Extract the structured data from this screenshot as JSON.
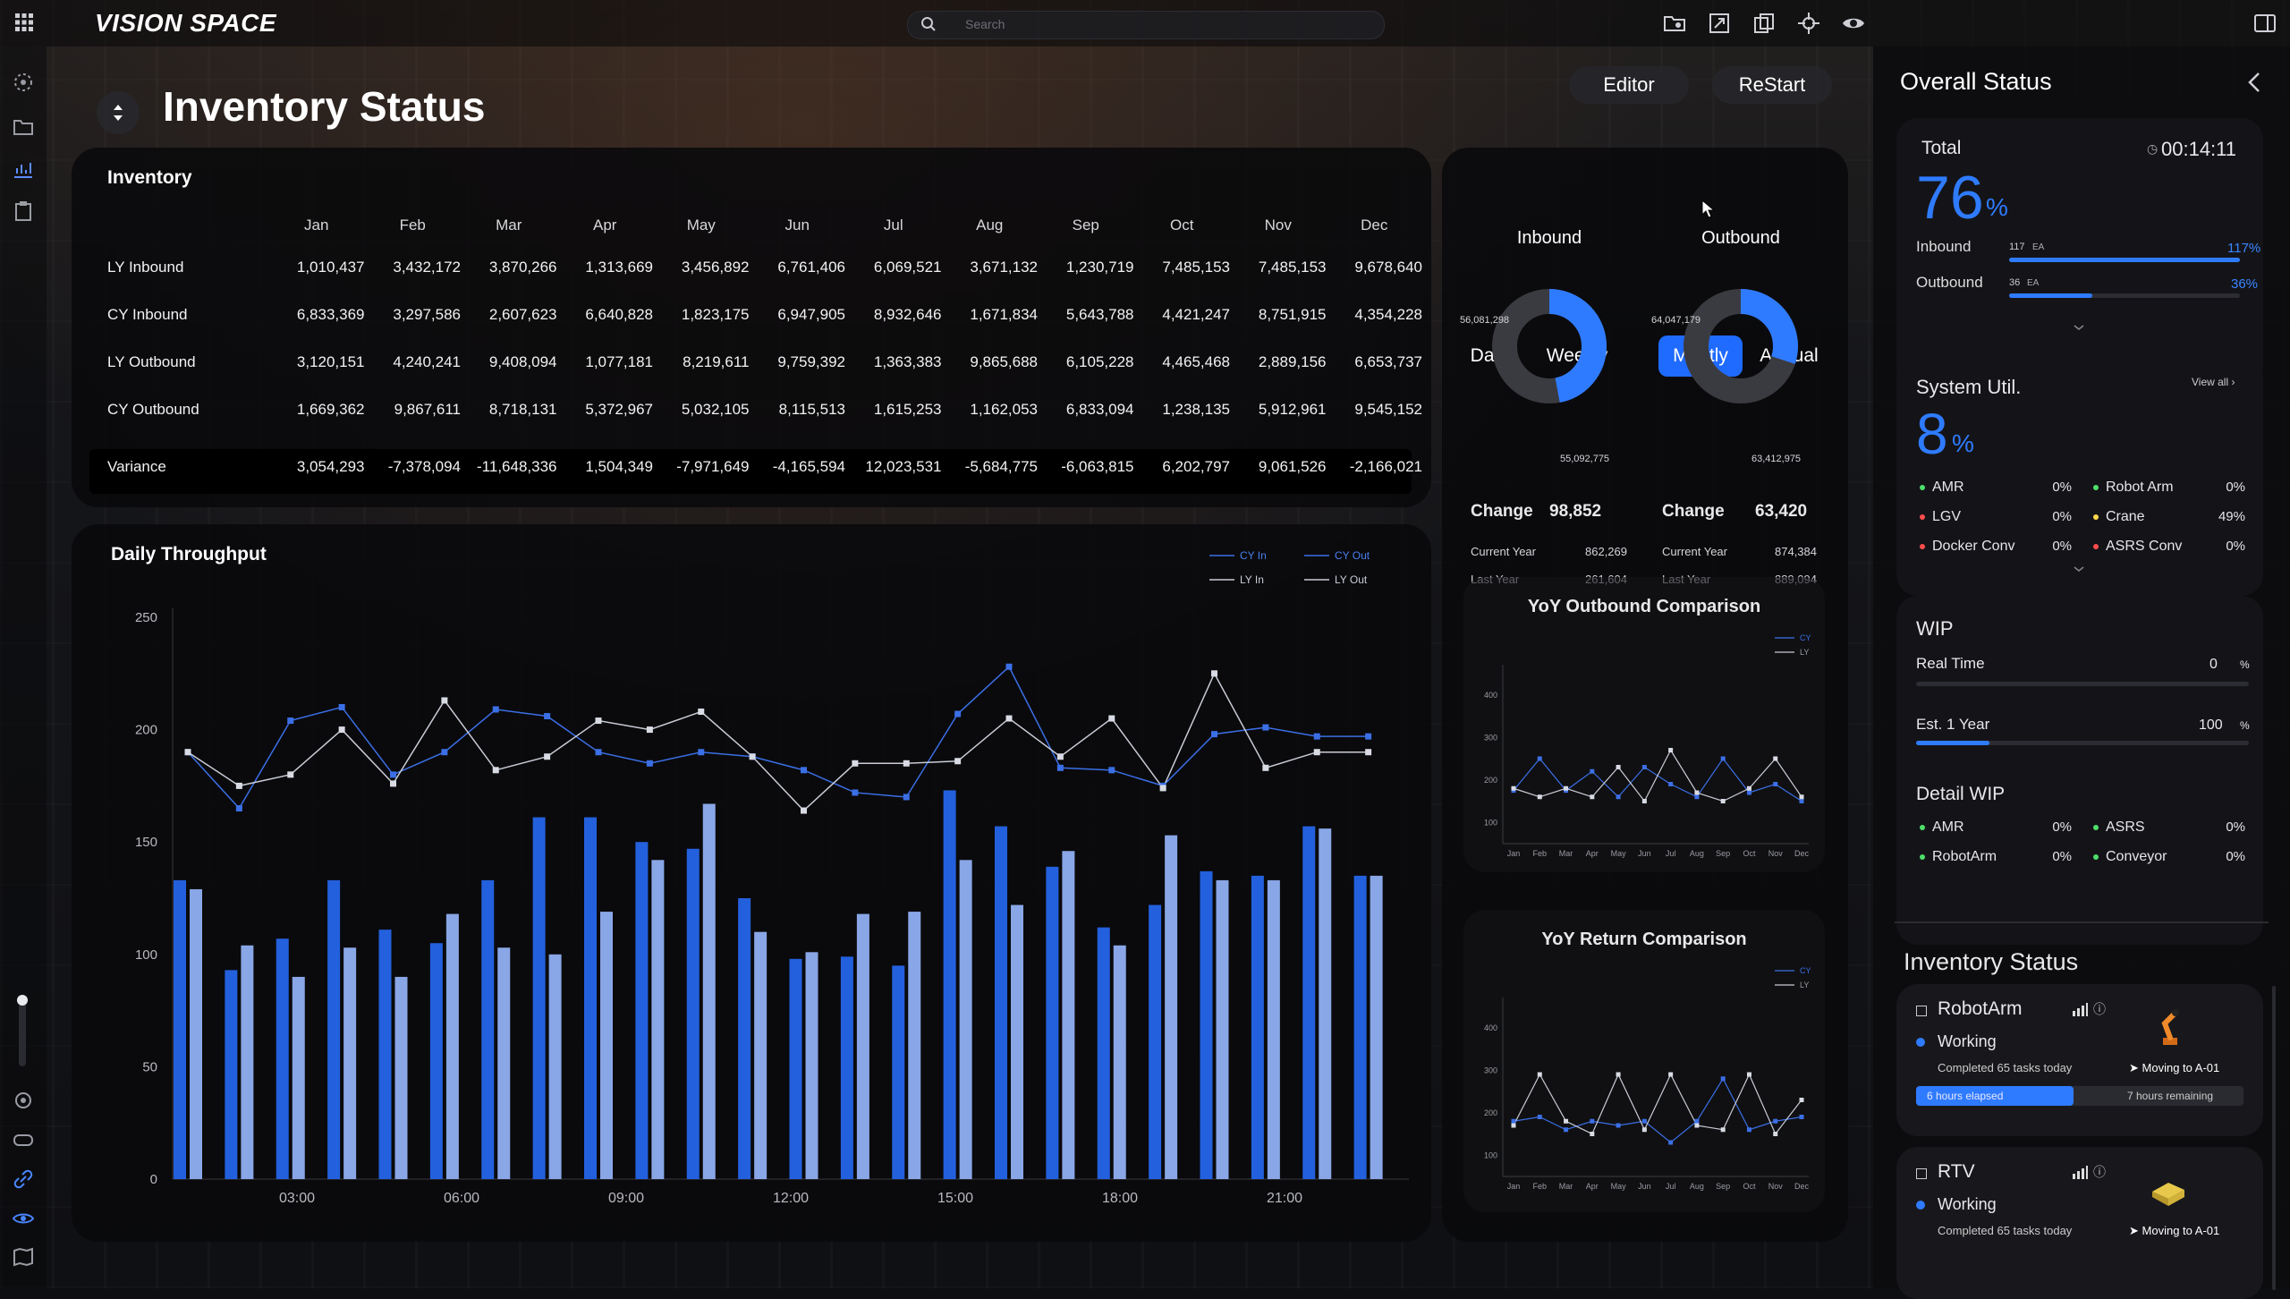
{
  "app": {
    "brand": "VISION SPACE",
    "search_placeholder": "Search"
  },
  "header": {
    "title": "Inventory Status",
    "editor_label": "Editor",
    "restart_label": "ReStart"
  },
  "inventory": {
    "title": "Inventory",
    "months": [
      "Jan",
      "Feb",
      "Mar",
      "Apr",
      "May",
      "Jun",
      "Jul",
      "Aug",
      "Sep",
      "Oct",
      "Nov",
      "Dec"
    ],
    "rows": [
      {
        "label": "LY Inbound",
        "values": [
          "1,010,437",
          "3,432,172",
          "3,870,266",
          "1,313,669",
          "3,456,892",
          "6,761,406",
          "6,069,521",
          "3,671,132",
          "1,230,719",
          "7,485,153",
          "7,485,153",
          "9,678,640"
        ]
      },
      {
        "label": "CY Inbound",
        "values": [
          "6,833,369",
          "3,297,586",
          "2,607,623",
          "6,640,828",
          "1,823,175",
          "6,947,905",
          "8,932,646",
          "1,671,834",
          "5,643,788",
          "4,421,247",
          "8,751,915",
          "4,354,228"
        ]
      },
      {
        "label": "LY Outbound",
        "values": [
          "3,120,151",
          "4,240,241",
          "9,408,094",
          "1,077,181",
          "8,219,611",
          "9,759,392",
          "1,363,383",
          "9,865,688",
          "6,105,228",
          "4,465,468",
          "2,889,156",
          "6,653,737"
        ]
      },
      {
        "label": "CY Outbound",
        "values": [
          "1,669,362",
          "9,867,611",
          "8,718,131",
          "5,372,967",
          "5,032,105",
          "8,115,513",
          "1,615,253",
          "1,162,053",
          "6,833,094",
          "1,238,135",
          "5,912,961",
          "9,545,152"
        ]
      }
    ],
    "variance": {
      "label": "Variance",
      "values": [
        "3,054,293",
        "-7,378,094",
        "-11,648,336",
        "1,504,349",
        "-7,971,649",
        "-4,165,594",
        "12,023,531",
        "-5,684,775",
        "-6,063,815",
        "6,202,797",
        "9,061,526",
        "-2,166,021"
      ]
    }
  },
  "period_tabs": [
    "Daily",
    "Weekly",
    "Montly",
    "Annual"
  ],
  "active_tab": "Montly",
  "inbound": {
    "title": "Inbound",
    "a": "56,081,298",
    "b": "55,092,775",
    "change_label": "Change",
    "change": "98,852",
    "cy_label": "Current Year",
    "cy": "862,269",
    "ly_label": "Last Year",
    "ly": "261,604",
    "share": 0.47
  },
  "outbound": {
    "title": "Outbound",
    "a": "64,047,179",
    "b": "63,412,975",
    "change_label": "Change",
    "change": "63,420",
    "cy_label": "Current Year",
    "cy": "874,384",
    "ly_label": "Last Year",
    "ly": "889,094",
    "share": 0.3
  },
  "yoy_outbound": {
    "title": "YoY Outbound Comparison",
    "legend": [
      "CY",
      "LY"
    ],
    "months": [
      "Jan",
      "Feb",
      "Mar",
      "Apr",
      "May",
      "Jun",
      "Jul",
      "Aug",
      "Sep",
      "Oct",
      "Nov",
      "Dec"
    ],
    "yticks": [
      "400",
      "300",
      "200",
      "100"
    ],
    "cy": [
      175,
      250,
      175,
      220,
      160,
      230,
      190,
      160,
      250,
      170,
      190,
      150
    ],
    "ly": [
      180,
      160,
      180,
      160,
      230,
      150,
      270,
      170,
      150,
      180,
      250,
      160
    ]
  },
  "yoy_return": {
    "title": "YoY Return Comparison",
    "legend": [
      "CY",
      "LY"
    ],
    "months": [
      "Jan",
      "Feb",
      "Mar",
      "Apr",
      "May",
      "Jun",
      "Jul",
      "Aug",
      "Sep",
      "Oct",
      "Nov",
      "Dec"
    ],
    "yticks": [
      "400",
      "300",
      "200",
      "100"
    ],
    "cy": [
      180,
      190,
      160,
      180,
      170,
      180,
      130,
      180,
      280,
      160,
      180,
      190
    ],
    "ly": [
      170,
      290,
      180,
      150,
      290,
      160,
      290,
      170,
      160,
      290,
      150,
      230
    ]
  },
  "overall": {
    "title": "Overall Status",
    "total_label": "Total",
    "total_value": "76",
    "pct": "%",
    "timer": "00:14:11",
    "inbound_label": "Inbound",
    "inbound_count": "117",
    "inbound_unit": "EA",
    "inbound_pct": "117%",
    "inbound_level": 1.0,
    "outbound_label": "Outbound",
    "outbound_count": "36",
    "outbound_unit": "EA",
    "outbound_pct": "36%",
    "outbound_level": 0.36
  },
  "system": {
    "title": "System Util.",
    "view_all": "View all",
    "value": "8",
    "pct": "%",
    "left": [
      {
        "name": "AMR",
        "value": "0%",
        "color": "#4ee06a"
      },
      {
        "name": "LGV",
        "value": "0%",
        "color": "#ff4d4d"
      },
      {
        "name": "Docker Conv",
        "value": "0%",
        "color": "#ff4d4d"
      }
    ],
    "right": [
      {
        "name": "Robot Arm",
        "value": "0%",
        "color": "#4ee06a"
      },
      {
        "name": "Crane",
        "value": "49%",
        "color": "#ffd84a"
      },
      {
        "name": "ASRS Conv",
        "value": "0%",
        "color": "#ff4d4d"
      }
    ]
  },
  "wip": {
    "title": "WIP",
    "real_label": "Real Time",
    "real_value": "0",
    "real_pct": "%",
    "real_level": 0.0,
    "est_label": "Est. 1 Year",
    "est_value": "100",
    "est_pct": "%",
    "est_level": 0.22,
    "detail_title": "Detail WIP",
    "left": [
      {
        "name": "AMR",
        "value": "0%",
        "color": "#4ee06a"
      },
      {
        "name": "RobotArm",
        "value": "0%",
        "color": "#4ee06a"
      }
    ],
    "right": [
      {
        "name": "ASRS",
        "value": "0%",
        "color": "#4ee06a"
      },
      {
        "name": "Conveyor",
        "value": "0%",
        "color": "#4ee06a"
      }
    ]
  },
  "inventory_status": {
    "title": "Inventory Status",
    "cards": [
      {
        "name": "RobotArm",
        "state": "Working",
        "tasks": "Completed 65 tasks today",
        "move": "Moving to A-01",
        "elapsed": "6 hours elapsed",
        "remaining": "7 hours remaining",
        "progress": 0.48
      },
      {
        "name": "RTV",
        "state": "Working",
        "tasks": "Completed 65 tasks today",
        "move": "Moving to A-01"
      }
    ]
  },
  "chart_data": {
    "type": "bar",
    "title": "Daily Throughput",
    "ylim": [
      0,
      250
    ],
    "yticks": [
      0,
      50,
      100,
      150,
      200,
      250
    ],
    "xticks": [
      "03:00",
      "06:00",
      "09:00",
      "12:00",
      "15:00",
      "18:00",
      "21:00"
    ],
    "legend": [
      "CY In",
      "CY Out",
      "LY In",
      "LY Out"
    ],
    "bars_cy": [
      133,
      93,
      107,
      133,
      111,
      105,
      133,
      161,
      161,
      150,
      147,
      125,
      98,
      99,
      95,
      173,
      157,
      139,
      112,
      122,
      137,
      135,
      157,
      135
    ],
    "bars_ly": [
      129,
      104,
      90,
      103,
      90,
      118,
      103,
      100,
      119,
      142,
      167,
      110,
      101,
      118,
      119,
      142,
      122,
      146,
      104,
      153,
      133,
      133,
      156,
      135
    ],
    "line_cy": [
      190,
      165,
      204,
      210,
      180,
      190,
      209,
      206,
      190,
      185,
      190,
      188,
      182,
      172,
      170,
      207,
      228,
      183,
      182,
      175,
      198,
      201,
      197,
      197
    ],
    "line_ly": [
      190,
      175,
      180,
      200,
      176,
      213,
      182,
      188,
      204,
      200,
      208,
      188,
      164,
      185,
      185,
      186,
      205,
      188,
      205,
      174,
      225,
      183,
      190,
      190
    ]
  }
}
